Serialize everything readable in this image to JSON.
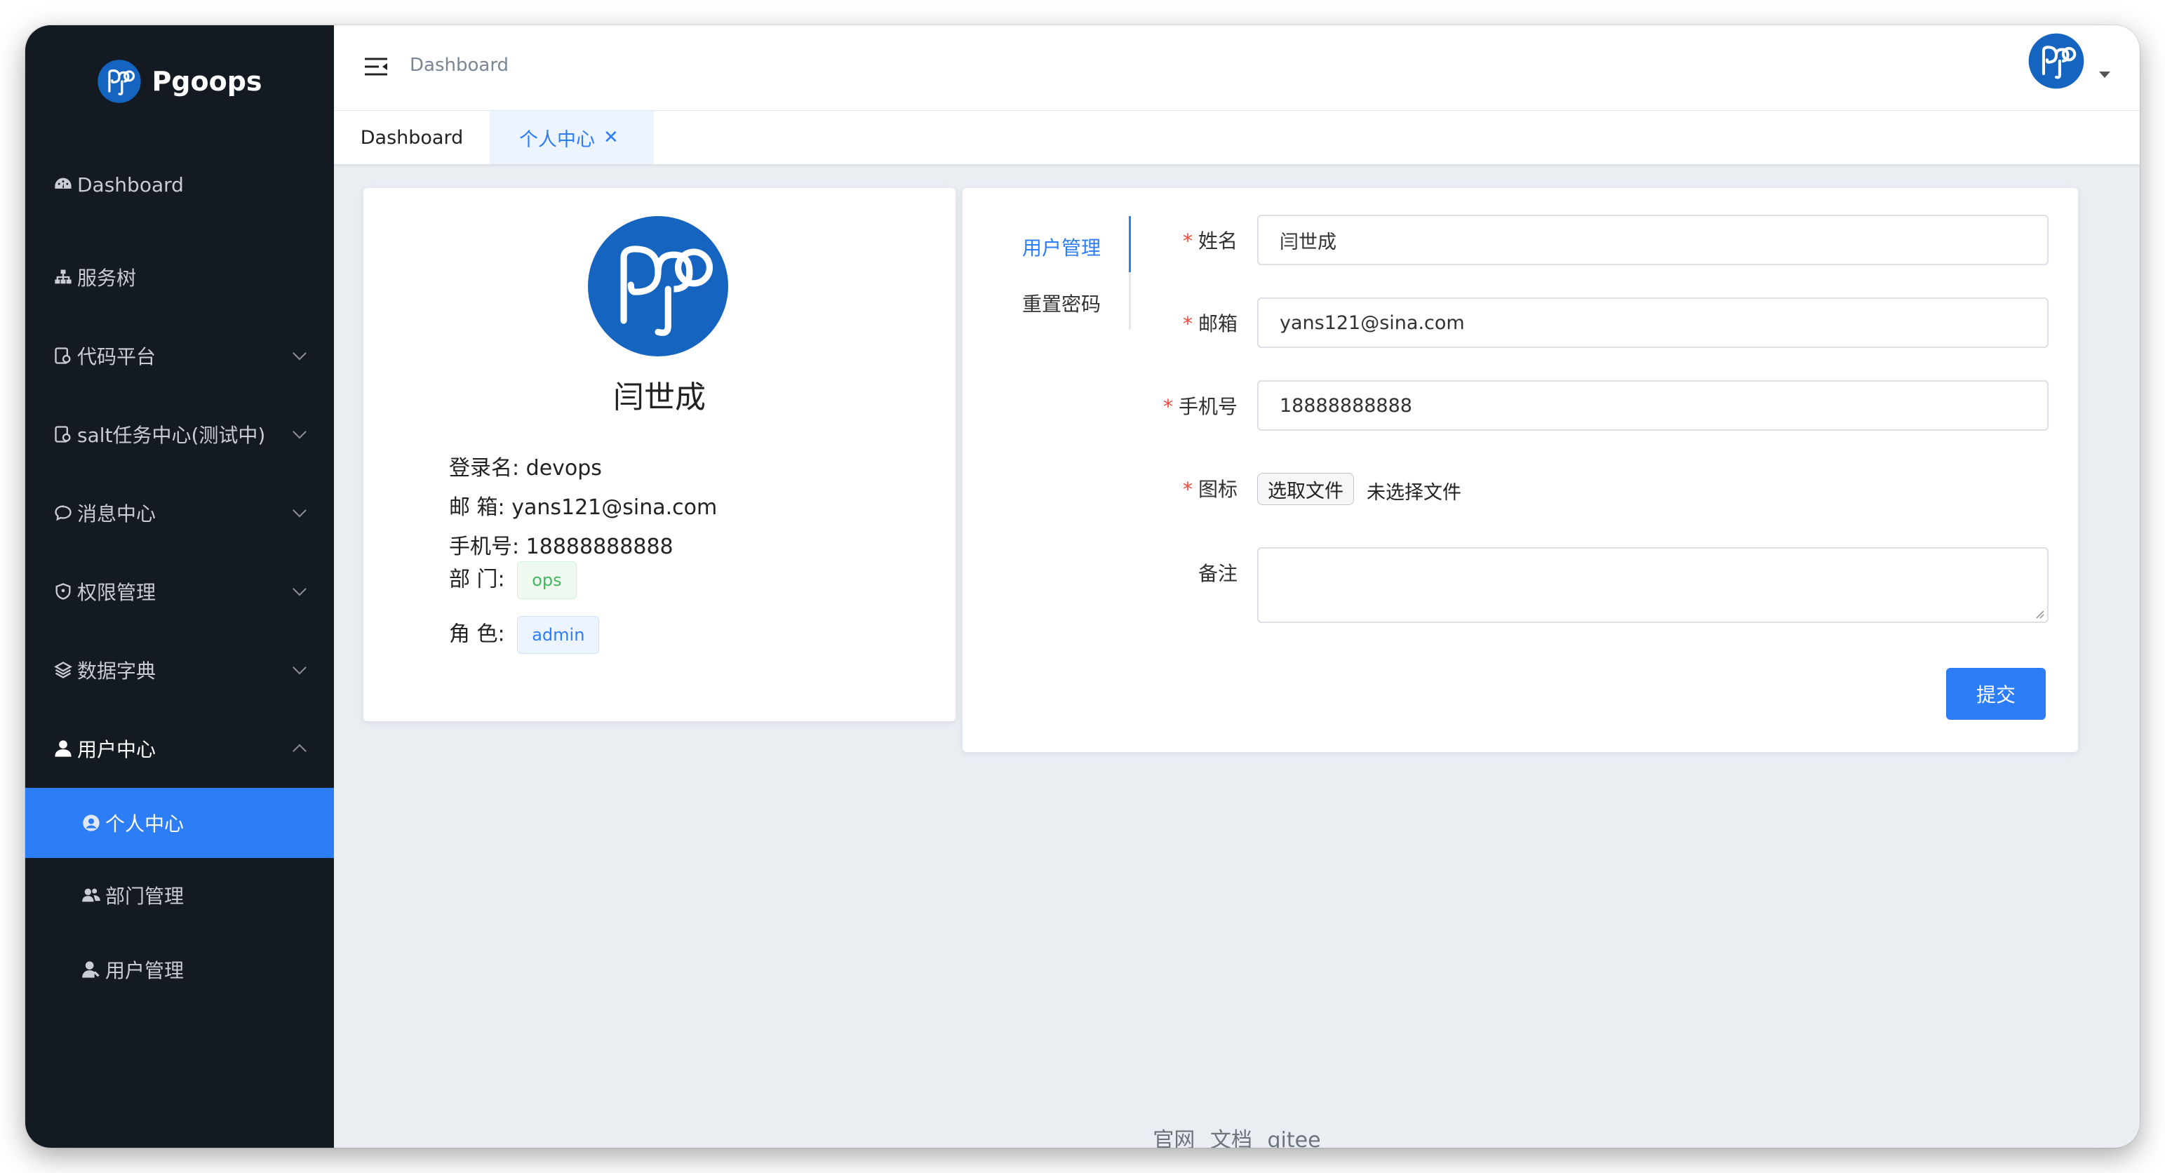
{
  "brand": {
    "name": "Pgoops"
  },
  "header": {
    "breadcrumb": "Dashboard"
  },
  "tabs": [
    {
      "label": "Dashboard"
    },
    {
      "label": "个人中心",
      "close": "✕"
    }
  ],
  "sidebar": {
    "items": [
      {
        "label": "Dashboard",
        "icon": "dashboard-icon"
      },
      {
        "label": "服务树",
        "icon": "sitemap-icon"
      },
      {
        "label": "代码平台",
        "icon": "code-doc-icon"
      },
      {
        "label": "salt任务中心(测试中)",
        "icon": "task-doc-icon"
      },
      {
        "label": "消息中心",
        "icon": "chat-icon"
      },
      {
        "label": "权限管理",
        "icon": "shield-icon"
      },
      {
        "label": "数据字典",
        "icon": "layers-icon"
      },
      {
        "label": "用户中心",
        "icon": "user-icon"
      }
    ],
    "sub_items": [
      {
        "label": "个人中心",
        "icon": "user-circle-icon"
      },
      {
        "label": "部门管理",
        "icon": "users-icon"
      },
      {
        "label": "用户管理",
        "icon": "user-manage-icon"
      }
    ]
  },
  "profile": {
    "name": "闫世成",
    "login_label": "登录名:",
    "login": "devops",
    "email_label": "邮 箱:",
    "email": "yans121@sina.com",
    "phone_label": "手机号:",
    "phone": "18888888888",
    "dept_label": "部 门:",
    "dept": "ops",
    "role_label": "角 色:",
    "role": "admin"
  },
  "form": {
    "tabs": [
      "用户管理",
      "重置密码"
    ],
    "required_mark": "*",
    "name_label": "姓名",
    "name_value": "闫世成",
    "email_label": "邮箱",
    "email_value": "yans121@sina.com",
    "phone_label": "手机号",
    "phone_value": "18888888888",
    "icon_label": "图标",
    "file_button": "选取文件",
    "file_none": "未选择文件",
    "remark_label": "备注",
    "remark_value": "",
    "submit": "提交"
  },
  "footer": {
    "links": [
      "官网",
      "文档",
      "gitee"
    ]
  },
  "colors": {
    "sidebar_bg": "#141a22",
    "accent": "#2d7df6",
    "content_bg": "#eaeef3"
  }
}
